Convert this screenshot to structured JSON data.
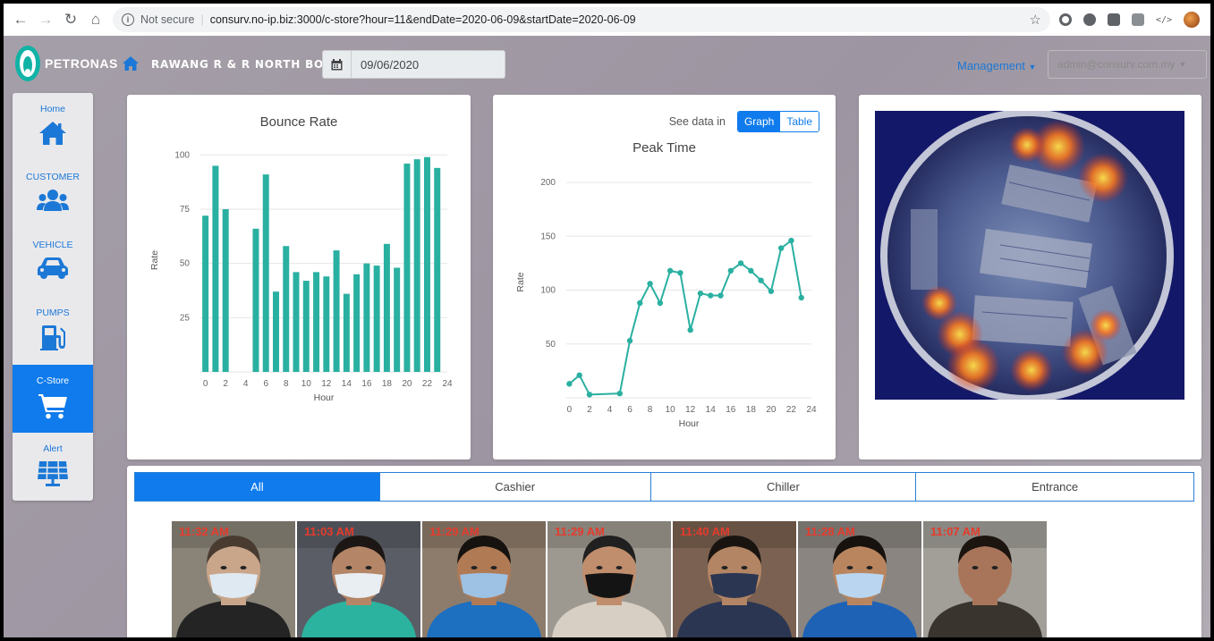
{
  "browser": {
    "security_label": "Not secure",
    "url": "consurv.no-ip.biz:3000/c-store?hour=11&endDate=2020-06-09&startDate=2020-06-09",
    "icons": [
      "back-icon",
      "forward-icon",
      "reload-icon",
      "home-icon",
      "info-icon",
      "star-icon",
      "extension-icon",
      "profile-avatar"
    ]
  },
  "header": {
    "brand": "PETRONAS",
    "station": "RAWANG R & R NORTH BOUND",
    "date": "09/06/2020",
    "management_label": "Management",
    "user_label": "admin@consurv.com.my"
  },
  "sidebar": {
    "items": [
      {
        "label": "Home",
        "icon": "home-icon"
      },
      {
        "label": "CUSTOMER",
        "icon": "users-icon"
      },
      {
        "label": "VEHICLE",
        "icon": "car-icon"
      },
      {
        "label": "PUMPS",
        "icon": "gas-pump-icon"
      },
      {
        "label": "C-Store",
        "icon": "cart-icon",
        "active": true
      },
      {
        "label": "Alert",
        "icon": "solar-panel-icon"
      }
    ]
  },
  "bounce": {
    "title": "Bounce Rate"
  },
  "peak": {
    "see_data_label": "See data in",
    "graph_label": "Graph",
    "table_label": "Table",
    "title": "Peak Time"
  },
  "chart_data": [
    {
      "type": "bar",
      "title": "Bounce Rate",
      "xlabel": "Hour",
      "ylabel": "Rate",
      "x": [
        0,
        1,
        2,
        5,
        6,
        7,
        8,
        9,
        10,
        11,
        12,
        13,
        14,
        15,
        16,
        17,
        18,
        19,
        20,
        21,
        22,
        23
      ],
      "values": [
        72,
        95,
        75,
        66,
        91,
        37,
        58,
        46,
        42,
        46,
        44,
        56,
        36,
        45,
        50,
        49,
        59,
        48,
        96,
        98,
        99,
        94
      ],
      "xticks": [
        "0",
        "2",
        "4",
        "6",
        "8",
        "10",
        "12",
        "14",
        "16",
        "18",
        "20",
        "22",
        "24"
      ],
      "yticks": [
        "25",
        "50",
        "75",
        "100"
      ],
      "xlim": [
        -0.5,
        24
      ],
      "ylim": [
        0,
        103
      ],
      "color": "#2ab0a1",
      "grid": true
    },
    {
      "type": "line",
      "title": "Peak Time",
      "xlabel": "Hour",
      "ylabel": "Rate",
      "x": [
        0,
        1,
        2,
        5,
        6,
        7,
        8,
        9,
        10,
        11,
        12,
        13,
        14,
        15,
        16,
        17,
        18,
        19,
        20,
        21,
        22,
        23
      ],
      "values": [
        13,
        21,
        3,
        4,
        53,
        88,
        106,
        88,
        118,
        116,
        63,
        97,
        95,
        95,
        118,
        125,
        118,
        109,
        99,
        139,
        146,
        93
      ],
      "xticks": [
        "0",
        "2",
        "4",
        "6",
        "8",
        "10",
        "12",
        "14",
        "16",
        "18",
        "20",
        "22",
        "24"
      ],
      "yticks": [
        "50",
        "100",
        "150",
        "200"
      ],
      "xlim": [
        -0.3,
        24
      ],
      "ylim": [
        0,
        215
      ],
      "color": "#2ab0a1",
      "grid": true
    }
  ],
  "tabs": [
    {
      "label": "All",
      "active": true
    },
    {
      "label": "Cashier"
    },
    {
      "label": "Chiller"
    },
    {
      "label": "Entrance"
    }
  ],
  "faces": [
    {
      "time": "11:32 AM",
      "bg": "#8a8478",
      "skin": "#c9a58a",
      "shirt": "#242424",
      "mask": "#dfe9f2",
      "hair": "#4a3b30"
    },
    {
      "time": "11:03 AM",
      "bg": "#5b5d66",
      "skin": "#b48566",
      "shirt": "#2bb39f",
      "mask": "#e8eef2",
      "hair": "#1c1714"
    },
    {
      "time": "11:29 AM",
      "bg": "#8d7c6c",
      "skin": "#b07a55",
      "shirt": "#1d6fc0",
      "mask": "#9dc2e4",
      "hair": "#16120f"
    },
    {
      "time": "11:29 AM",
      "bg": "#9e9990",
      "skin": "#c08e6d",
      "shirt": "#d8cfc4",
      "mask": "#141414",
      "hair": "#202020"
    },
    {
      "time": "11:40 AM",
      "bg": "#7a6151",
      "skin": "#b38564",
      "shirt": "#2b3653",
      "mask": "#2b3653",
      "hair": "#1a1410"
    },
    {
      "time": "11:28 AM",
      "bg": "#8a8580",
      "skin": "#b9855f",
      "shirt": "#1e62b6",
      "mask": "#b9d5ef",
      "hair": "#17120e"
    },
    {
      "time": "11:07 AM",
      "bg": "#a19f98",
      "skin": "#a8755a",
      "shirt": "#39342e",
      "mask": "#a8755a",
      "hair": "#1b140f"
    }
  ],
  "colors": {
    "accent": "#0f7bec",
    "chart": "#2ab0a1",
    "timestamp": "#e53b2c"
  }
}
